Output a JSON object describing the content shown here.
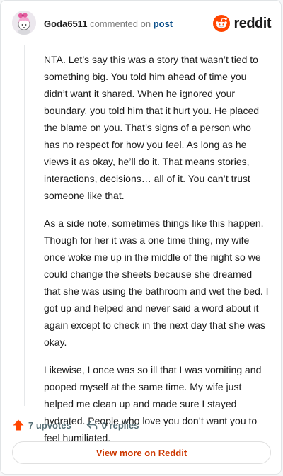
{
  "header": {
    "author": "Goda6511",
    "commented_text": "commented on",
    "post_link": "post",
    "brand": "reddit"
  },
  "comment": {
    "paragraphs": [
      "NTA. Let’s say this was a story that wasn’t tied to something big. You told him ahead of time you didn’t want it shared. When he ignored your boundary, you told him that it hurt you. He placed the blame on you. That’s signs of a person who has no respect for how you feel. As long as he views it as okay, he’ll do it. That means stories, interactions, decisions… all of it. You can’t trust someone like that.",
      "As a side note, sometimes things like this happen. Though for her it was a one time thing, my wife once woke me up in the middle of the night so we could change the sheets because she dreamed that she was using the bathroom and wet the bed. I got up and helped and never said a word about it again except to check in the next day that she was okay.",
      "Likewise, I once was so ill that I was vomiting and pooped myself at the same time. My wife just helped me clean up and made sure I stayed hydrated. People who love you don’t want you to feel humiliated."
    ]
  },
  "actions": {
    "upvotes": "7 upvotes",
    "replies": "0 replies",
    "upvote_icon": "upvote-arrow-icon",
    "reply_icon": "reply-arrow-icon"
  },
  "footer": {
    "view_more": "View more on Reddit"
  },
  "colors": {
    "reddit_orange": "#ff4500",
    "link_blue": "#0a4f8a",
    "view_more_text": "#cc3700",
    "muted_text": "#576f76"
  }
}
